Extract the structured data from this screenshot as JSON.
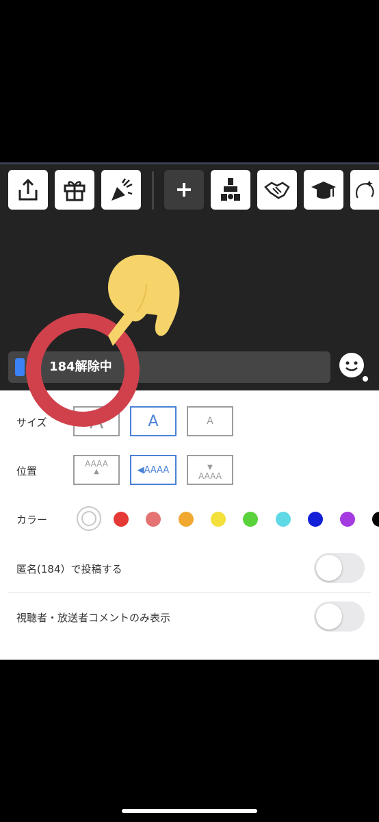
{
  "toolbar": {
    "buttons": [
      {
        "name": "share-icon"
      },
      {
        "name": "gift-icon"
      },
      {
        "name": "party-popper-icon"
      },
      {
        "name": "plus-icon"
      },
      {
        "name": "blocks-icon"
      },
      {
        "name": "handshake-icon"
      },
      {
        "name": "graduation-cap-icon"
      },
      {
        "name": "sparkle-face-icon"
      }
    ]
  },
  "comment": {
    "text": "184解除中"
  },
  "settings": {
    "size_label": "サイズ",
    "size_options": [
      "A",
      "A",
      "A"
    ],
    "position_label": "位置",
    "position_options": [
      "AAAA",
      "◀AAAA",
      "AAAA"
    ],
    "color_label": "カラー",
    "colors": [
      "#ffffff",
      "#e53935",
      "#e57373",
      "#f0a830",
      "#f4e03a",
      "#5ad23c",
      "#5fd9e6",
      "#1320d8",
      "#a43be0",
      "#000000"
    ],
    "anonymous_label": "匿名(184）で投稿する",
    "viewer_only_label": "視聴者・放送者コメントのみ表示"
  },
  "annotation": {
    "ring_color": "#d0414c",
    "hand_color": "#f6d46a"
  }
}
